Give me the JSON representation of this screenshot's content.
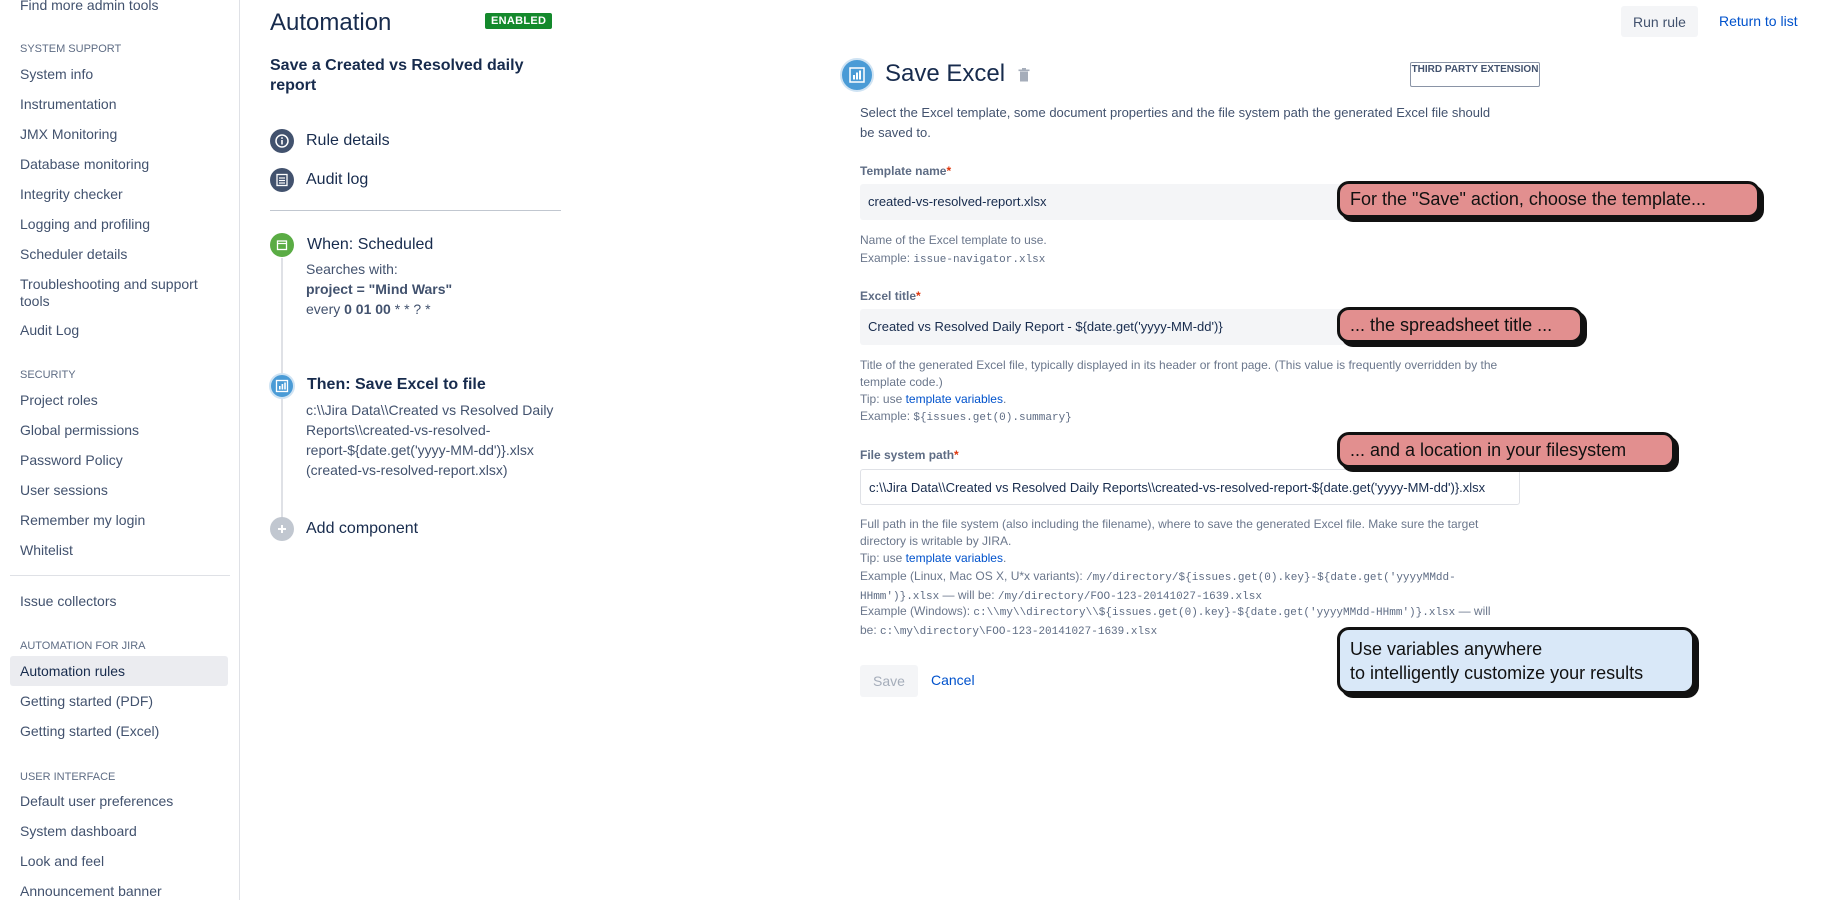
{
  "sidebar": {
    "top_partial": "Find more admin tools",
    "system_support": {
      "heading": "SYSTEM SUPPORT",
      "items": [
        "System info",
        "Instrumentation",
        "JMX Monitoring",
        "Database monitoring",
        "Integrity checker",
        "Logging and profiling",
        "Scheduler details",
        "Troubleshooting and support tools",
        "Audit Log"
      ]
    },
    "security": {
      "heading": "SECURITY",
      "items": [
        "Project roles",
        "Global permissions",
        "Password Policy",
        "User sessions",
        "Remember my login",
        "Whitelist"
      ]
    },
    "issue_collectors": "Issue collectors",
    "automation": {
      "heading": "AUTOMATION FOR JIRA",
      "items": [
        "Automation rules",
        "Getting started (PDF)",
        "Getting started (Excel)"
      ],
      "active": "Automation rules"
    },
    "user_interface": {
      "heading": "USER INTERFACE",
      "items": [
        "Default user preferences",
        "System dashboard",
        "Look and feel",
        "Announcement banner"
      ]
    }
  },
  "header": {
    "title": "Automation",
    "status_badge": "ENABLED",
    "run_rule": "Run rule",
    "return_to_list": "Return to list"
  },
  "rule": {
    "name": "Save a Created vs Resolved daily report",
    "rule_details": "Rule details",
    "audit_log": "Audit log",
    "trigger": {
      "title": "When: Scheduled",
      "line1": "Searches with:",
      "line2": "project = \"Mind Wars\"",
      "line3_prefix": "every ",
      "line3_cron": "0 01 00",
      "line3_suffix": " * * ? *"
    },
    "action": {
      "title": "Then: Save Excel to file",
      "lines": [
        "c:\\\\Jira Data\\\\Created vs Resolved Daily",
        "Reports\\\\created-vs-resolved-",
        "report-${date.get('yyyy-MM-dd')}.xlsx",
        "(created-vs-resolved-report.xlsx)"
      ]
    },
    "add_component": "Add component"
  },
  "form": {
    "title": "Save Excel",
    "badge": "THIRD PARTY EXTENSION",
    "description": "Select the Excel template, some document properties and the file system path the generated Excel file should be saved to.",
    "template": {
      "label": "Template name",
      "required": "*",
      "value": "created-vs-resolved-report.xlsx",
      "help": "Name of the Excel template to use.",
      "example_label": "Example: ",
      "example_code": "issue-navigator.xlsx"
    },
    "excel_title": {
      "label": "Excel title",
      "required": "*",
      "value": "Created vs Resolved Daily Report - ${date.get('yyyy-MM-dd')}",
      "help": "Title of the generated Excel file, typically displayed in its header or front page. (This value is frequently overridden by the template code.)",
      "tip_prefix": "Tip: use ",
      "tip_link": "template variables",
      "tip_suffix": ".",
      "example_label": "Example: ",
      "example_code": "${issues.get(0).summary}"
    },
    "path": {
      "label": "File system path",
      "required": "*",
      "value": "c:\\\\Jira Data\\\\Created vs Resolved Daily Reports\\\\created-vs-resolved-report-${date.get('yyyy-MM-dd')}.xlsx",
      "help": "Full path in the file system (also including the filename), where to save the generated Excel file. Make sure the target directory is writable by JIRA.",
      "tip_prefix": "Tip: use ",
      "tip_link": "template variables",
      "tip_suffix": ".",
      "ex1_label": "Example (Linux, Mac OS X, U*x variants): ",
      "ex1_code": "/my/directory/${issues.get(0).key}-${date.get('yyyyMMdd-HHmm')}.xlsx",
      "ex1_mid": " — will be: ",
      "ex1_result": "/my/directory/FOO-123-20141027-1639.xlsx",
      "ex2_label": "Example (Windows): ",
      "ex2_code": "c:\\\\my\\\\directory\\\\${issues.get(0).key}-${date.get('yyyyMMdd-HHmm')}.xlsx",
      "ex2_mid": " — will be: ",
      "ex2_result": "c:\\my\\directory\\FOO-123-20141027-1639.xlsx"
    },
    "save": "Save",
    "cancel": "Cancel"
  },
  "callouts": {
    "template": "For the \"Save\" action, choose the template...",
    "title": "... the spreadsheet title ...",
    "location": "... and a location in your filesystem",
    "variables_line1": "Use variables anywhere",
    "variables_line2": "to intelligently customize your results"
  },
  "colors": {
    "callout_pink": "#e28f8f",
    "callout_blue": "#d9e8f8",
    "enabled_green": "#14892c",
    "link_blue": "#0052cc"
  }
}
